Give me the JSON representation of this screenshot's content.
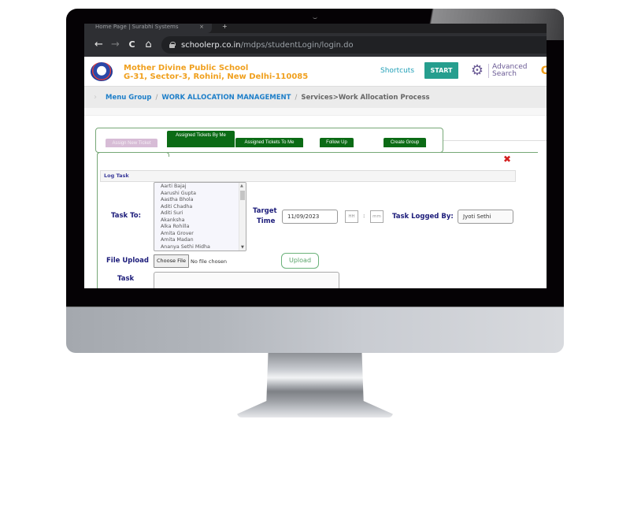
{
  "browser": {
    "tab_title": "Home Page | Surabhi Systems",
    "tab_close": "×",
    "new_tab": "+",
    "nav": {
      "back": "←",
      "forward": "→",
      "reload": "C",
      "home": "⌂"
    },
    "url_host": "schoolerp.co.in",
    "url_path": "/mdps/studentLogin/login.do"
  },
  "header": {
    "school_name": "Mother Divine Public School",
    "school_address": "G-31, Sector-3, Rohini, New Delhi-110085",
    "shortcuts_label": "Shortcuts",
    "start_label": "START",
    "advanced_search_line1": "Advanced",
    "advanced_search_line2": "Search",
    "edge_glyph": "C"
  },
  "breadcrumb": {
    "chevron": "›",
    "items": [
      "Menu Group",
      "WORK ALLOCATION MANAGEMENT"
    ],
    "separator": "/",
    "current": "Services>Work Allocation Process"
  },
  "tabs": [
    {
      "label": "Assign New Ticket",
      "active": false
    },
    {
      "label": "Assigned Tickets By Me",
      "active": true
    },
    {
      "label": "Assigned Tickets To Me",
      "active": true
    },
    {
      "label": "Follow Up",
      "active": true
    },
    {
      "label": "Create Group",
      "active": true
    }
  ],
  "form": {
    "close_glyph": "✖",
    "section_title": "Log Task",
    "task_to_label": "Task To:",
    "assignees": [
      "Aarti Bajaj",
      "Aarushi Gupta",
      "Aastha Bhola",
      "Aditi Chadha",
      "Aditi Suri",
      "Akanksha",
      "Alka Rohilla",
      "Amita Grover",
      "Amita Madan",
      "Ananya Sethi Midha"
    ],
    "target_time_label_1": "Target",
    "target_time_label_2": "Time",
    "target_date": "11/09/2023",
    "hour_placeholder": "HH",
    "time_sep": ":",
    "minute_placeholder": "mm",
    "logged_by_label": "Task Logged By:",
    "logged_by_value": "Jyoti Sethi",
    "file_upload_label": "File Upload",
    "choose_file_label": "Choose File",
    "no_file_text": "No file chosen",
    "upload_label": "Upload",
    "task_label": "Task",
    "task_value": ""
  },
  "colors": {
    "brand_orange": "#f0a01e",
    "start_teal": "#269e8e",
    "tab_green": "#0b6b15",
    "tab_inactive": "#d7bcd6",
    "label_navy": "#1c1c7a",
    "close_red": "#d42020"
  }
}
